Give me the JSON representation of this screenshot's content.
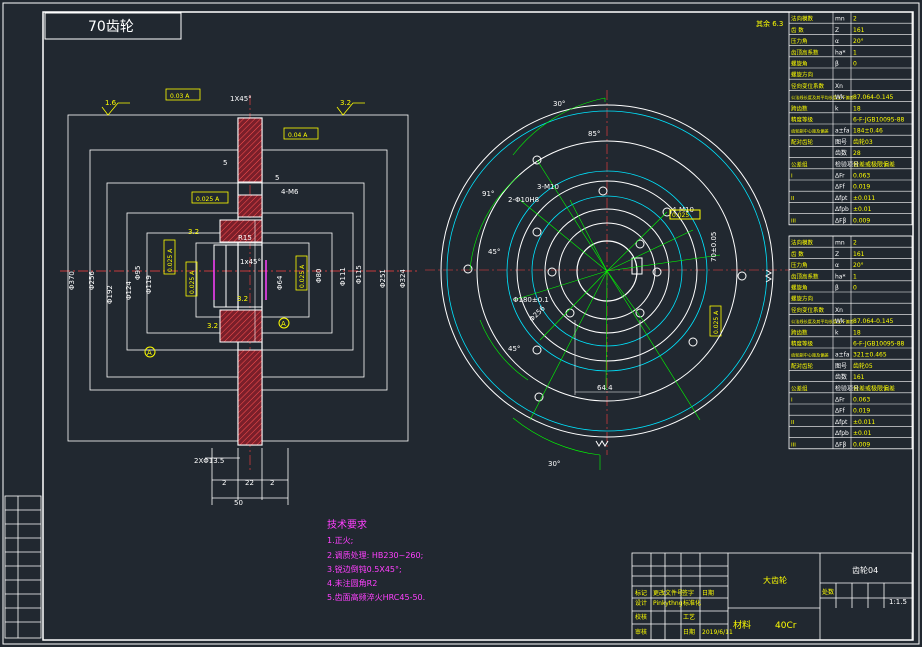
{
  "title_box": {
    "text": "70齿轮"
  },
  "tolerances": {
    "top": "0.03 A",
    "flat_face": "0.04 A",
    "hub": "0.025 A",
    "bore_left": "0.025 A",
    "bore_mid": "0.025 A",
    "bore_right": "0.025 A",
    "keyway": "0.025 A"
  },
  "dims": {
    "chamfer_top": "1X45°",
    "chamfer_mid": "1x45°",
    "five_a": "5",
    "five_b": "5",
    "holes_left": "4-M6",
    "r15": "R15",
    "rough_16": "1.6",
    "rough_32a": "3.2",
    "rough_32b": "3.2",
    "rough_32c": "3.2",
    "rough_32d": "3.2",
    "d370": "Φ370",
    "d256": "Φ256",
    "d192": "Φ192",
    "d124": "Φ124",
    "d119": "Φ119",
    "d95": "Φ95",
    "d80": "Φ80",
    "d64": "Φ64",
    "d115": "Φ115",
    "d111": "Φ111",
    "d251": "Φ251",
    "d324": "Φ324",
    "two_x": "2XΦ13.5",
    "w2a": "2",
    "w22": "22",
    "w2b": "2",
    "w50": "50",
    "datum_a1": "A",
    "datum_a2": "A"
  },
  "front_view": {
    "ang_30_top": "30°",
    "ang_85": "85°",
    "ang_91": "91°",
    "m10": "3-M10",
    "holes_2": "2-Φ10H8",
    "holes_4": "4-M10",
    "ang_45a": "45°",
    "ang_45b": "45°",
    "d180": "Φ180±0.1",
    "d256": "Φ256",
    "dim_64": "64.4",
    "dim_70": "70±0.05",
    "ang_30_bot": "30°",
    "tol_key": "0.025"
  },
  "tech": {
    "heading": "技术要求",
    "items": [
      "1.正火;",
      "2.调质处理: HB230~260;",
      "3.锐边倒钝0.5X45°;",
      "4.未注圆角R2",
      "5.齿面高频淬火HRC45-50."
    ]
  },
  "param_table_1": {
    "rows": [
      [
        "法向模数",
        "mn",
        "2"
      ],
      [
        "齿  数",
        "Z",
        "161"
      ],
      [
        "压力角",
        "α",
        "20°"
      ],
      [
        "齿顶高系数",
        "ha*",
        "1"
      ],
      [
        "螺旋角",
        "β",
        "0"
      ],
      [
        "螺旋方向",
        "",
        ""
      ],
      [
        "径向变位系数",
        "Xn",
        ""
      ],
      [
        "公法线长度及其平均长度上下偏差",
        "Wk",
        "87.064-0.145"
      ],
      [
        "跨齿数",
        "k",
        "18"
      ],
      [
        "精度等级",
        "",
        "6-F-JGB10095-88"
      ],
      [
        "齿轮副中心距及偏差",
        "a±fa",
        "184±0.46"
      ],
      [
        "配对齿轮",
        "图号",
        "齿轮03"
      ],
      [
        "",
        "齿数",
        "28"
      ],
      [
        "公差组",
        "检验项目",
        "公差或极限偏差"
      ],
      [
        "I",
        "ΔFr",
        "0.063"
      ],
      [
        "",
        "ΔFf",
        "0.019"
      ],
      [
        "II",
        "Δfpt",
        "±0.011"
      ],
      [
        "",
        "Δfpb",
        "±0.01"
      ],
      [
        "III",
        "ΔFβ",
        "0.009"
      ]
    ]
  },
  "param_table_2": {
    "rows": [
      [
        "法向模数",
        "mn",
        "2"
      ],
      [
        "齿  数",
        "Z",
        "161"
      ],
      [
        "压力角",
        "α",
        "20°"
      ],
      [
        "齿顶高系数",
        "ha*",
        "1"
      ],
      [
        "螺旋角",
        "β",
        "0"
      ],
      [
        "螺旋方向",
        "",
        ""
      ],
      [
        "径向变位系数",
        "Xn",
        ""
      ],
      [
        "公法线长度及其平均长度上下偏差",
        "Wk",
        "87.064-0.145"
      ],
      [
        "跨齿数",
        "k",
        "18"
      ],
      [
        "精度等级",
        "",
        "6-F-JGB10095-88"
      ],
      [
        "齿轮副中心距及偏差",
        "a±fa",
        "321±0.465"
      ],
      [
        "配对齿轮",
        "图号",
        "齿轮05"
      ],
      [
        "",
        "齿数",
        "161"
      ],
      [
        "公差组",
        "检验项目",
        "公差或极限偏差"
      ],
      [
        "I",
        "ΔFr",
        "0.063"
      ],
      [
        "",
        "ΔFf",
        "0.019"
      ],
      [
        "II",
        "Δfpt",
        "±0.011"
      ],
      [
        "",
        "Δfpb",
        "±0.01"
      ],
      [
        "III",
        "ΔFβ",
        "0.009"
      ]
    ]
  },
  "rough_top_right": "其余 6.3",
  "title_block": {
    "part_name": "大齿轮",
    "drawing_no": "齿轮04",
    "material_label": "材料",
    "material": "40Cr",
    "scale": "1:1.5",
    "row1": [
      "标记",
      "处数",
      "更改文件号",
      "签字",
      "日期"
    ],
    "row2": [
      "设计",
      "Pinkythng",
      "标准化"
    ],
    "row3": [
      "校核",
      "",
      "工艺"
    ],
    "row4": [
      "审核",
      "",
      "日期",
      "2019/6/11"
    ],
    "designer_date": "2019/6/11"
  },
  "colors": {
    "bg": "#212830",
    "white": "#ffffff",
    "yellow": "#ffff00",
    "cyan": "#00e5ff",
    "green": "#00ff00",
    "magenta": "#ff40ff",
    "red_hatch": "#ff3030"
  }
}
